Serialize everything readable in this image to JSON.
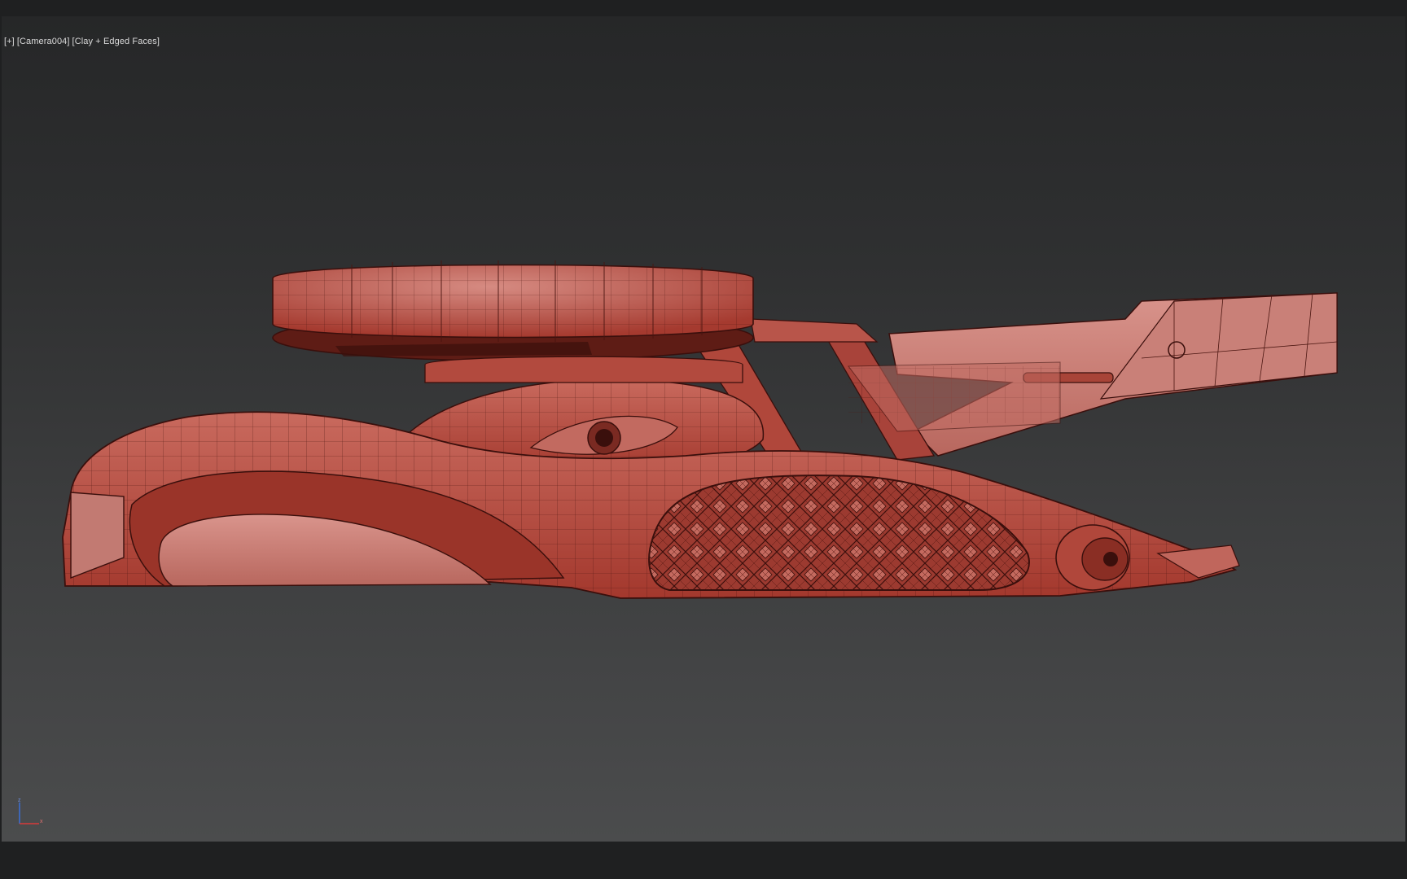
{
  "viewport": {
    "menu_label": "[+]",
    "camera_label": "[Camera004]",
    "shading_label": "[Clay + Edged Faces]"
  },
  "gizmo": {
    "z_label": "z",
    "x_label": "x",
    "z_color": "#3a6fd8",
    "x_color": "#d83a3a"
  },
  "model": {
    "clay_color": "#b44a3c",
    "clay_light": "#c97a72",
    "edge_color": "#3a0f0c"
  }
}
